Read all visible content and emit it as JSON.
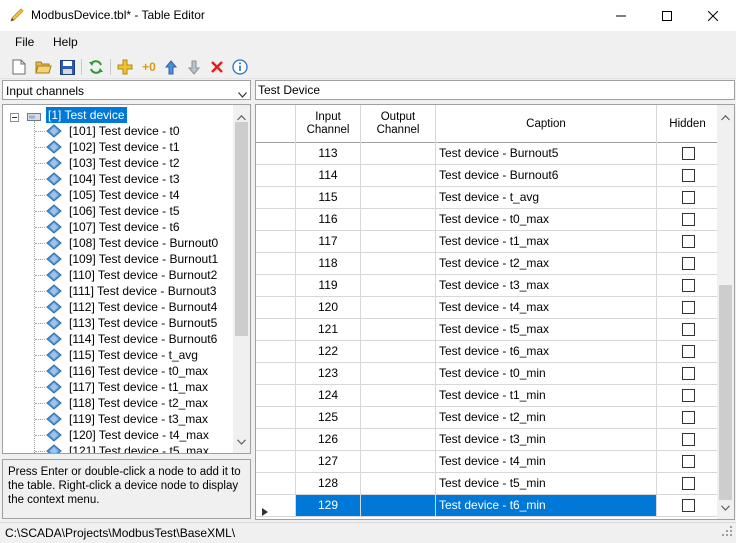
{
  "window": {
    "title": "ModbusDevice.tbl* - Table Editor",
    "icon": "pencil-icon"
  },
  "menu": [
    "File",
    "Help"
  ],
  "toolbar": {
    "buttons": [
      "new-file-icon",
      "open-folder-icon",
      "save-icon",
      "refresh-icon",
      "add-item-icon",
      "add-zero-icon",
      "move-up-icon",
      "move-down-icon",
      "delete-icon",
      "info-icon"
    ],
    "add_zero_text": "+0"
  },
  "selector": {
    "value": "Input channels"
  },
  "tree": {
    "root": "[1] Test device",
    "items": [
      "[101] Test device - t0",
      "[102] Test device - t1",
      "[103] Test device - t2",
      "[104] Test device - t3",
      "[105] Test device - t4",
      "[106] Test device - t5",
      "[107] Test device - t6",
      "[108] Test device - Burnout0",
      "[109] Test device - Burnout1",
      "[110] Test device - Burnout2",
      "[111] Test device - Burnout3",
      "[112] Test device - Burnout4",
      "[113] Test device - Burnout5",
      "[114] Test device - Burnout6",
      "[115] Test device - t_avg",
      "[116] Test device - t0_max",
      "[117] Test device - t1_max",
      "[118] Test device - t2_max",
      "[119] Test device - t3_max",
      "[120] Test device - t4_max",
      "[121] Test device - t5_max"
    ]
  },
  "help_text": "Press Enter or double-click a node to add it to the table. Right-click a device node to display the context menu.",
  "caption_field": {
    "value": "Test Device"
  },
  "grid": {
    "columns": [
      "Input Channel",
      "Output Channel",
      "Caption",
      "Hidden"
    ],
    "rows": [
      {
        "input": "113",
        "output": "",
        "caption": "Test device - Burnout5",
        "hidden": false
      },
      {
        "input": "114",
        "output": "",
        "caption": "Test device - Burnout6",
        "hidden": false
      },
      {
        "input": "115",
        "output": "",
        "caption": "Test device - t_avg",
        "hidden": false
      },
      {
        "input": "116",
        "output": "",
        "caption": "Test device - t0_max",
        "hidden": false
      },
      {
        "input": "117",
        "output": "",
        "caption": "Test device - t1_max",
        "hidden": false
      },
      {
        "input": "118",
        "output": "",
        "caption": "Test device - t2_max",
        "hidden": false
      },
      {
        "input": "119",
        "output": "",
        "caption": "Test device - t3_max",
        "hidden": false
      },
      {
        "input": "120",
        "output": "",
        "caption": "Test device - t4_max",
        "hidden": false
      },
      {
        "input": "121",
        "output": "",
        "caption": "Test device - t5_max",
        "hidden": false
      },
      {
        "input": "122",
        "output": "",
        "caption": "Test device - t6_max",
        "hidden": false
      },
      {
        "input": "123",
        "output": "",
        "caption": "Test device - t0_min",
        "hidden": false
      },
      {
        "input": "124",
        "output": "",
        "caption": "Test device - t1_min",
        "hidden": false
      },
      {
        "input": "125",
        "output": "",
        "caption": "Test device - t2_min",
        "hidden": false
      },
      {
        "input": "126",
        "output": "",
        "caption": "Test device - t3_min",
        "hidden": false
      },
      {
        "input": "127",
        "output": "",
        "caption": "Test device - t4_min",
        "hidden": false
      },
      {
        "input": "128",
        "output": "",
        "caption": "Test device - t5_min",
        "hidden": false
      },
      {
        "input": "129",
        "output": "",
        "caption": "Test device - t6_min",
        "hidden": false,
        "selected": true
      }
    ]
  },
  "status": {
    "path": "C:\\SCADA\\Projects\\ModbusTest\\BaseXML\\"
  },
  "colors": {
    "selection": "#0078d7",
    "chrome": "#f0f0f0"
  }
}
